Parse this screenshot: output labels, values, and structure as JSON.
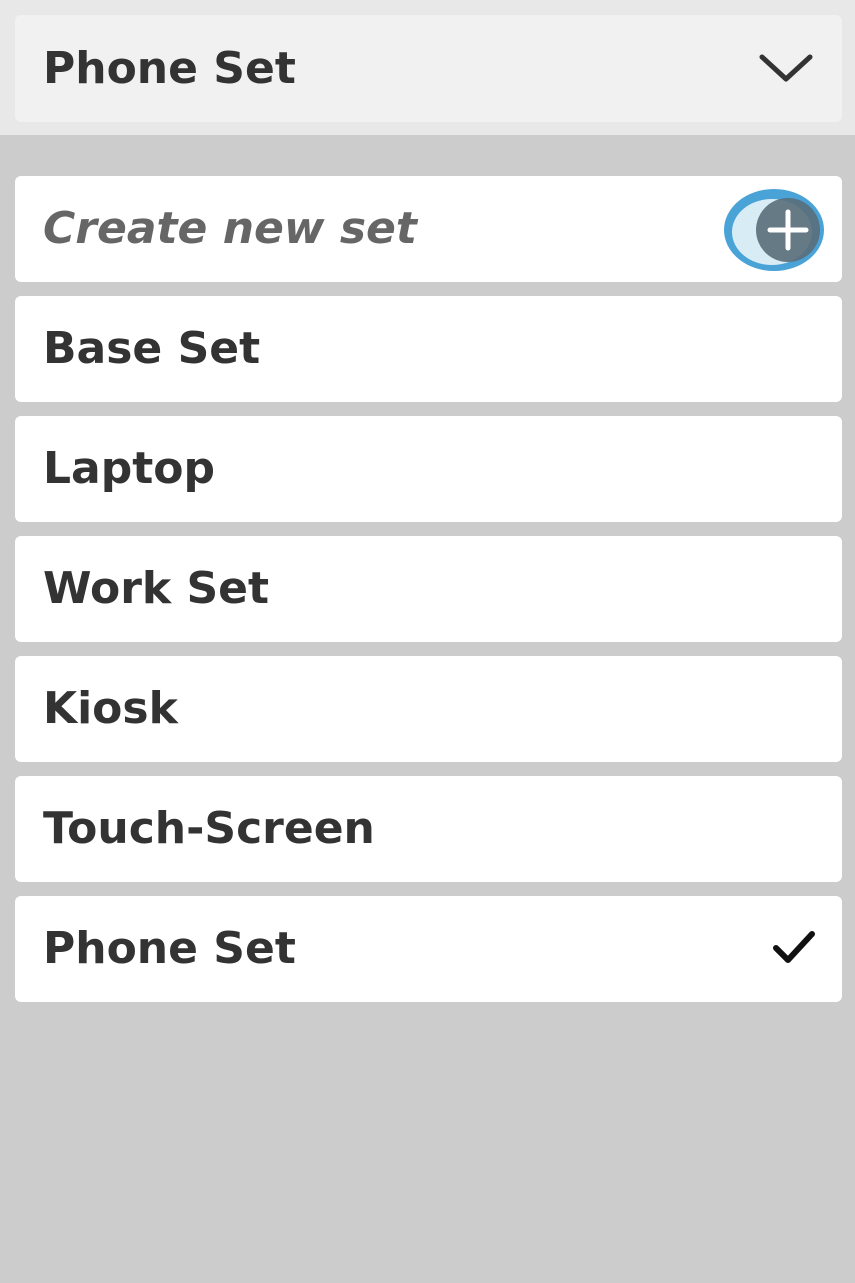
{
  "header": {
    "title": "Phone Set",
    "icon": "chevron-down-icon"
  },
  "create": {
    "label": "Create new set",
    "icon": "plus-icon",
    "icon_color": "#4aa3d6"
  },
  "sets": [
    {
      "label": "Base Set",
      "selected": false
    },
    {
      "label": "Laptop",
      "selected": false
    },
    {
      "label": "Work Set",
      "selected": false
    },
    {
      "label": "Kiosk",
      "selected": false
    },
    {
      "label": "Touch-Screen",
      "selected": false
    },
    {
      "label": "Phone Set",
      "selected": true
    }
  ],
  "selected_icon": "check-icon",
  "colors": {
    "background": "#cccccc",
    "header_bg": "#f1f1f1",
    "item_bg": "#ffffff",
    "text": "#333333",
    "accent": "#4aa3d6"
  }
}
